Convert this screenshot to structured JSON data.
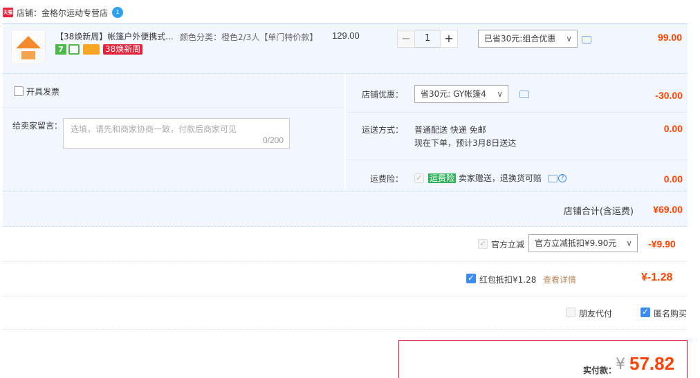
{
  "shop": {
    "badge": "天猫",
    "name": "店铺：金格尔运动专营店",
    "ww_badge": "1"
  },
  "item": {
    "title": "【38焕新周】帐篷户外便携式...",
    "badge_7": "7",
    "badge_38": "38焕新周",
    "sku": "颜色分类：橙色2/3人【单门特价款】",
    "unit_price": "129.00",
    "quantity": "1",
    "qty_minus": "−",
    "qty_plus": "+",
    "promo_select": "已省30元:组合优惠",
    "subtotal": "99.00"
  },
  "invoice": {
    "label": "开具发票"
  },
  "message": {
    "label": "给卖家留言：",
    "placeholder": "选填，请先和商家协商一致，付款后商家可见",
    "count": "0/200"
  },
  "shop_coupon": {
    "label": "店铺优惠：",
    "select": "省30元: GY帐篷4",
    "amount": "-30.00"
  },
  "shipping": {
    "label": "运送方式：",
    "method": "普通配送 快递 免邮",
    "eta": "现在下单，预计3月8日送达",
    "amount": "0.00"
  },
  "insurance": {
    "label": "运费险：",
    "tag": "运费险",
    "desc": "卖家赠送，退换货可赔",
    "help": "?",
    "amount": "0.00"
  },
  "shop_total": {
    "label": "店铺合计(含运费)",
    "amount": "¥69.00"
  },
  "official_discount": {
    "label": "官方立减",
    "select": "官方立减抵扣¥9.90元",
    "amount": "-¥9.90"
  },
  "red_packet": {
    "label": "红包抵扣¥1.28",
    "link": "查看详情",
    "amount": "¥-1.28"
  },
  "options": {
    "friend_pay": "朋友代付",
    "anonymous": "匿名购买"
  },
  "payment": {
    "label": "实付款：",
    "currency": "¥",
    "amount": "57.82"
  },
  "colors": {
    "accent_red": "#ff4400",
    "blue": "#3b8cf0",
    "panel_bg": "#f2f7ff"
  }
}
